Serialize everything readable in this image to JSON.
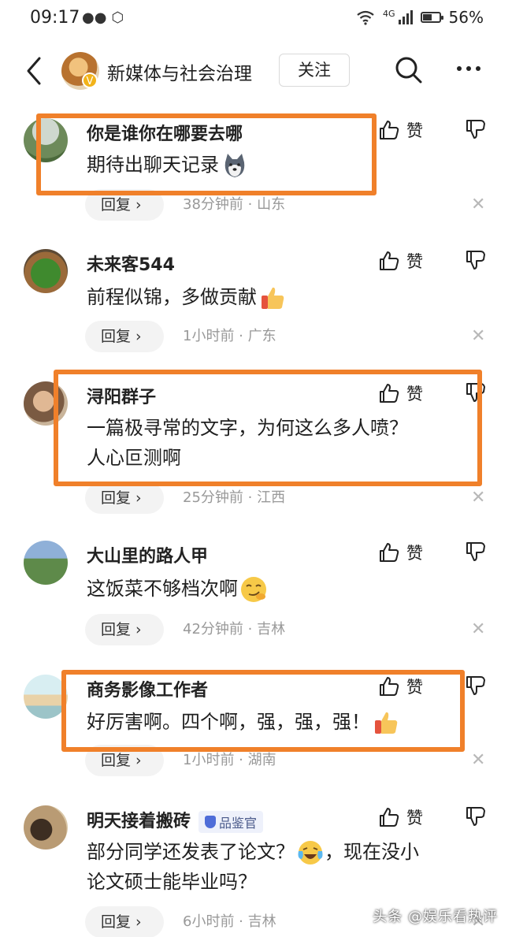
{
  "status_bar": {
    "time": "09:17",
    "network": "4G",
    "battery": "56%",
    "battery_level": 0.56
  },
  "header": {
    "channel_name": "新媒体与社会治理",
    "follow_label": "关注",
    "verified_mark": "V"
  },
  "comments": [
    {
      "user": "你是谁你在哪要去哪",
      "lines": [
        "期待出聊天记录"
      ],
      "emoji": "husky-emoji",
      "like_label": "赞",
      "reply_label": "回复 ›",
      "meta": "38分钟前 · 山东",
      "highlighted": true
    },
    {
      "user": "未来客544",
      "lines": [
        "前程似锦，多做贡献"
      ],
      "emoji": "thumbs-up-emoji",
      "like_label": "赞",
      "reply_label": "回复 ›",
      "meta": "1小时前 · 广东",
      "highlighted": false
    },
    {
      "user": "浔阳群子",
      "lines": [
        "一篇极寻常的文字，为何这么多人喷？",
        "人心叵测啊"
      ],
      "emoji": "",
      "like_label": "赞",
      "reply_label": "回复 ›",
      "meta": "25分钟前 · 江西",
      "highlighted": true
    },
    {
      "user": "大山里的路人甲",
      "lines": [
        "这饭菜不够档次啊"
      ],
      "emoji": "smirk-emoji",
      "like_label": "赞",
      "reply_label": "回复 ›",
      "meta": "42分钟前 · 吉林",
      "highlighted": false
    },
    {
      "user": "商务影像工作者",
      "lines": [
        "好厉害啊。四个啊，强，强，强！"
      ],
      "emoji": "thumbs-up-emoji",
      "like_label": "赞",
      "reply_label": "回复 ›",
      "meta": "1小时前 · 湖南",
      "highlighted": true
    },
    {
      "user": "明天接着搬砖",
      "badge": "品鉴官",
      "lines": [
        "部分同学还发表了论文？",
        "论文硕士能毕业吗？"
      ],
      "line1_suffix": "，现在没小",
      "emoji": "crying-laughing-emoji",
      "like_label": "赞",
      "reply_label": "回复 ›",
      "meta": "6小时前 · 吉林",
      "highlighted": false
    }
  ],
  "watermark": "头条 @娱乐看热评",
  "colors": {
    "highlight": "#f0802a",
    "meta_gray": "#999999",
    "badge_blue": "#4f6dd8"
  }
}
